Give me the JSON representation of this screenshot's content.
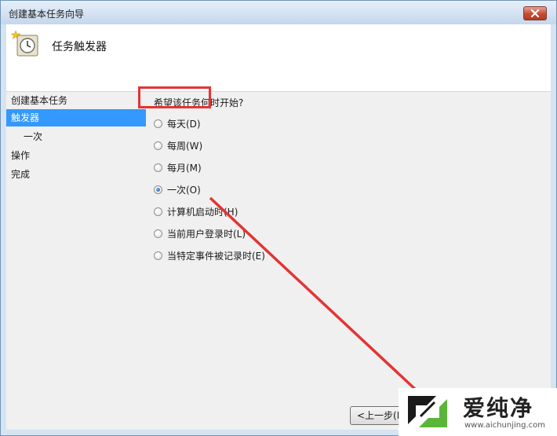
{
  "window": {
    "title": "创建基本任务向导"
  },
  "header": {
    "title": "任务触发器"
  },
  "nav": {
    "items": [
      {
        "label": "创建基本任务",
        "active": false,
        "sub": false
      },
      {
        "label": "触发器",
        "active": true,
        "sub": false
      },
      {
        "label": "一次",
        "active": false,
        "sub": true
      },
      {
        "label": "操作",
        "active": false,
        "sub": false
      },
      {
        "label": "完成",
        "active": false,
        "sub": false
      }
    ]
  },
  "main": {
    "question": "希望该任务何时开始?",
    "options": [
      {
        "label": "每天(D)",
        "checked": false
      },
      {
        "label": "每周(W)",
        "checked": false
      },
      {
        "label": "每月(M)",
        "checked": false
      },
      {
        "label": "一次(O)",
        "checked": true
      },
      {
        "label": "计算机启动时(H)",
        "checked": false
      },
      {
        "label": "当前用户登录时(L)",
        "checked": false
      },
      {
        "label": "当特定事件被记录时(E)",
        "checked": false
      }
    ]
  },
  "buttons": {
    "back": "<上一步(B"
  },
  "watermark": {
    "text": "爱纯净",
    "url": "www.aichunjing.com"
  },
  "colors": {
    "highlight": "#e33434",
    "nav_active": "#3399ff"
  }
}
